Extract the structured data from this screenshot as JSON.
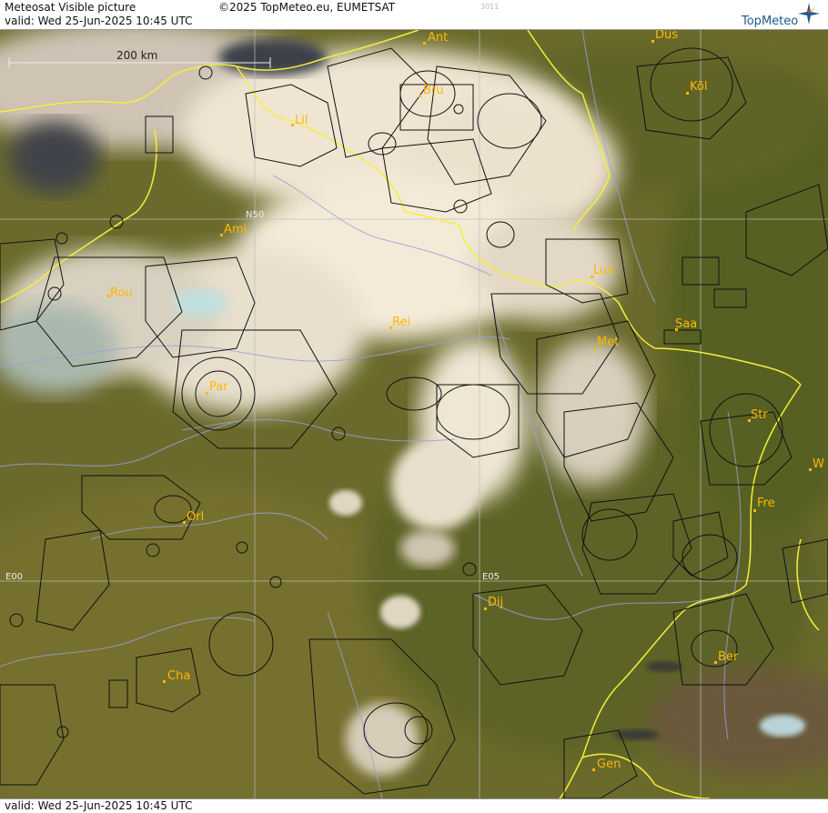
{
  "header": {
    "title": "Meteosat Visible picture",
    "copyright": "©2025 TopMeteo.eu, EUMETSAT",
    "code": "3011",
    "valid": "valid:  Wed  25-Jun-2025  10:45 UTC",
    "logo": "TopMeteo"
  },
  "footer": {
    "valid": "valid:  Wed  25-Jun-2025  10:45 UTC"
  },
  "scale": {
    "label": "200 km"
  },
  "grid_labels": {
    "lat": "N50",
    "lon_west": "E00",
    "lon_east": "E05"
  },
  "cities": {
    "ant": "Ant",
    "dus": "Düs",
    "bru": "Bru",
    "kol": "Köl",
    "lil": "Lil",
    "ami": "Ami",
    "rou": "Rou",
    "lux": "Lux",
    "rei": "Rei",
    "saa": "Saa",
    "met": "Met",
    "par": "Par",
    "str": "Str",
    "fre": "Fre",
    "orl": "Orl",
    "dij": "Dij",
    "ber": "Ber",
    "cha": "Cha",
    "gen": "Gen",
    "w": "W"
  },
  "colors": {
    "terrain": "#6f6a2e",
    "clouds": "#f3ead8",
    "borders": "#f5ef3a",
    "rivers": "#9aa0d8",
    "airspace": "#111111",
    "labels": "#ffb800"
  }
}
